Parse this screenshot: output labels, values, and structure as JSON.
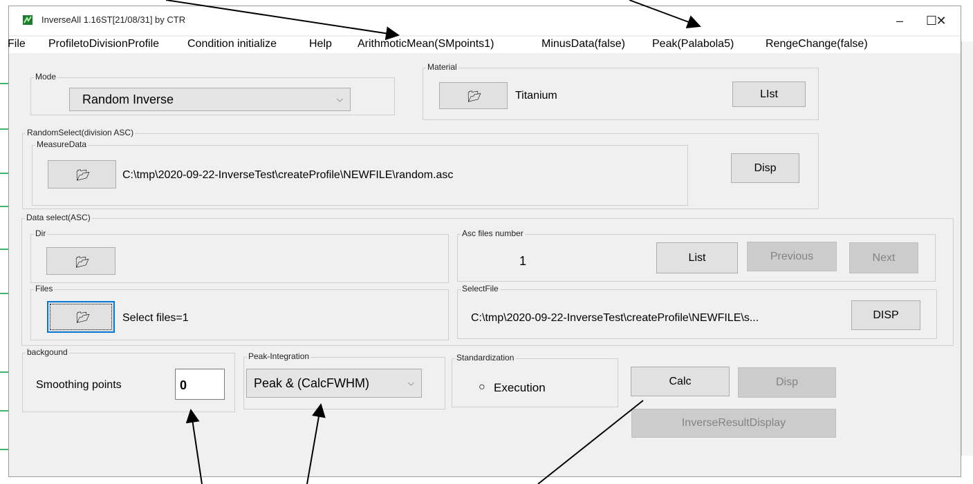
{
  "window": {
    "title": "InverseAll 1.16ST[21/08/31] by CTR",
    "minimize": "–",
    "maximize": "☐",
    "close": "✕"
  },
  "menu": {
    "file": "File",
    "profile_to_division": "ProfiletoDivisionProfile",
    "condition_initialize": "Condition initialize",
    "help": "Help",
    "arithmetic_mean": "ArithmoticMean(SMpoints1)",
    "minus_data": "MinusData(false)",
    "peak": "Peak(Palabola5)",
    "range_change": "RengeChange(false)"
  },
  "mode": {
    "label": "Mode",
    "selected": "Random Inverse"
  },
  "material": {
    "label": "Material",
    "name": "Titanium",
    "list_button": "LIst"
  },
  "random_select": {
    "label": "RandomSelect(division ASC)",
    "measure_label": "MeasureData",
    "path": "C:\\tmp\\2020-09-22-InverseTest\\createProfile\\NEWFILE\\random.asc",
    "disp_button": "Disp"
  },
  "data_select": {
    "label": "Data select(ASC)",
    "dir_label": "Dir",
    "files_label": "Files",
    "files_text": "Select files=1",
    "asc_label": "Asc files number",
    "asc_number": "1",
    "list_button": "List",
    "previous_button": "Previous",
    "next_button": "Next",
    "select_file_label": "SelectFile",
    "select_file_path": "C:\\tmp\\2020-09-22-InverseTest\\createProfile\\NEWFILE\\s...",
    "disp_button": "DISP"
  },
  "background": {
    "label": "backgound",
    "smoothing_label": "Smoothing points",
    "smoothing_value": "0"
  },
  "peak_integration": {
    "label": "Peak-Integration",
    "selected": "Peak & (CalcFWHM)"
  },
  "standardization": {
    "label": "Standardization",
    "execution": "Execution"
  },
  "actions": {
    "calc": "Calc",
    "disp": "Disp",
    "inverse_result": "InverseResultDisplay"
  },
  "icons": {
    "folder": "folder-open-icon",
    "app": "app-icon",
    "dropdown": "chevron-down-icon",
    "radio": "radio-icon"
  },
  "colors": {
    "window_bg": "#f0f0f0",
    "button_bg": "#e1e1e1",
    "disabled_bg": "#cccccc",
    "focus_border": "#0078d7"
  }
}
